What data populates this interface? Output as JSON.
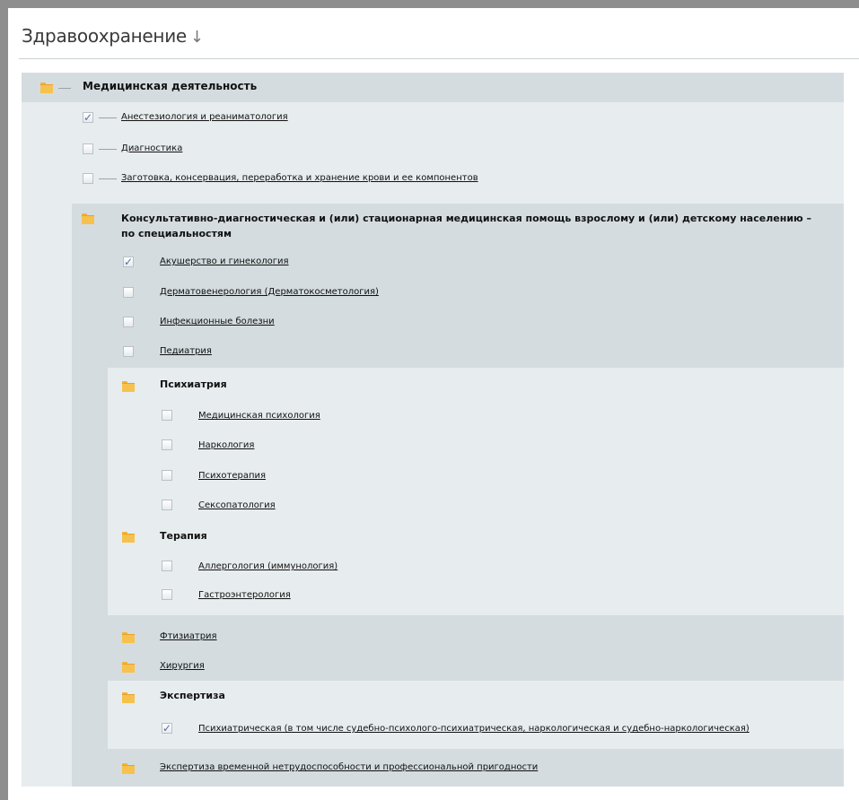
{
  "header": {
    "title": "Здравоохранение",
    "sort_icon": "↓"
  },
  "sections": {
    "root": {
      "label": "Медицинская деятельность",
      "icon": "folder-icon"
    },
    "root_items": [
      {
        "label": "Анестезиология и реаниматология",
        "checked": true,
        "mark": "✓"
      },
      {
        "label": "Диагностика",
        "checked": false,
        "mark": ""
      },
      {
        "label": "Заготовка, консервация, переработка и хранение крови и ее компонентов",
        "checked": false,
        "mark": ""
      }
    ],
    "consult": {
      "label": "Консультативно-диагностическая и (или) стационарная медицинская помощь взрослому и (или) детскому населению – по специальностям",
      "icon": "folder-icon"
    },
    "consult_items": [
      {
        "label": "Акушерство и гинекология",
        "checked": true,
        "mark": "✓"
      },
      {
        "label": "Дерматовенерология (Дерматокосметология)",
        "checked": false,
        "mark": ""
      },
      {
        "label": "Инфекционные болезни",
        "checked": false,
        "mark": ""
      },
      {
        "label": "Педиатрия",
        "checked": false,
        "mark": ""
      }
    ],
    "psych": {
      "label": "Психиатрия"
    },
    "psych_items": [
      {
        "label": "Медицинская психология",
        "mark": ""
      },
      {
        "label": "Наркология",
        "mark": ""
      },
      {
        "label": "Психотерапия",
        "mark": ""
      },
      {
        "label": "Сексопатология",
        "mark": ""
      }
    ],
    "therapy": {
      "label": "Терапия"
    },
    "therapy_items": [
      {
        "label": "Аллергология (иммунология)",
        "mark": ""
      },
      {
        "label": "Гастроэнтерология",
        "mark": ""
      }
    ],
    "ftiz": {
      "label": "Фтизиатрия"
    },
    "surg": {
      "label": "Хирургия"
    },
    "exp": {
      "label": "Экспертиза"
    },
    "exp_items": [
      {
        "label": "Психиатрическая (в том числе судебно-психолого-психиатрическая, наркологическая и судебно-наркологическая)",
        "checked": true,
        "mark": "✓"
      }
    ],
    "exp_temp": {
      "label": "Экспертиза временной нетрудоспособности и профессиональной пригодности"
    }
  },
  "colors": {
    "band_dark": "#d4dcdf",
    "band_light": "#e7ecee",
    "accent_folder": "#f6c24d",
    "check": "#5570a8"
  }
}
